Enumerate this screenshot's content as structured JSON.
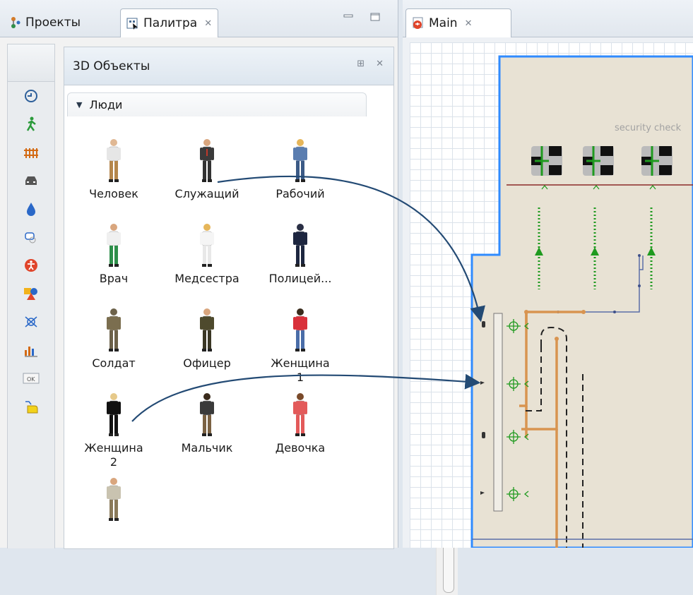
{
  "left_tabs": {
    "projects": "Проекты",
    "palette": "Палитра"
  },
  "right_tab": {
    "main": "Main"
  },
  "panel": {
    "title": "3D Объекты"
  },
  "category": {
    "label": "Люди"
  },
  "items": [
    {
      "label": "Человек",
      "icon": "person-white-shirt"
    },
    {
      "label": "Служащий",
      "icon": "person-office-suit"
    },
    {
      "label": "Рабочий",
      "icon": "person-worker"
    },
    {
      "label": "Врач",
      "icon": "person-doctor"
    },
    {
      "label": "Медсестра",
      "icon": "person-nurse"
    },
    {
      "label": "Полицей...",
      "icon": "person-police"
    },
    {
      "label": "Солдат",
      "icon": "person-soldier"
    },
    {
      "label": "Офицер",
      "icon": "person-officer"
    },
    {
      "label": "Женщина\n1",
      "icon": "person-woman-red"
    },
    {
      "label": "Женщина\n2",
      "icon": "person-woman-black"
    },
    {
      "label": "Мальчик",
      "icon": "person-boy"
    },
    {
      "label": "Девочка",
      "icon": "person-girl"
    },
    {
      "label": "",
      "icon": "person-extra"
    }
  ],
  "toolbar_icons": [
    "process-modeling-icon",
    "pedestrian-icon",
    "rail-icon",
    "road-traffic-icon",
    "fluid-icon",
    "agent-icon",
    "accessibility-icon",
    "presentation-icon",
    "space-markup-icon",
    "analysis-icon",
    "controls-icon",
    "connectivity-icon"
  ],
  "canvas": {
    "security_label": "security check"
  },
  "colors": {
    "floor": "#e8e2d4",
    "wall": "#2f8bff",
    "accent_path": "#d89450",
    "arrow": "#234a74"
  }
}
